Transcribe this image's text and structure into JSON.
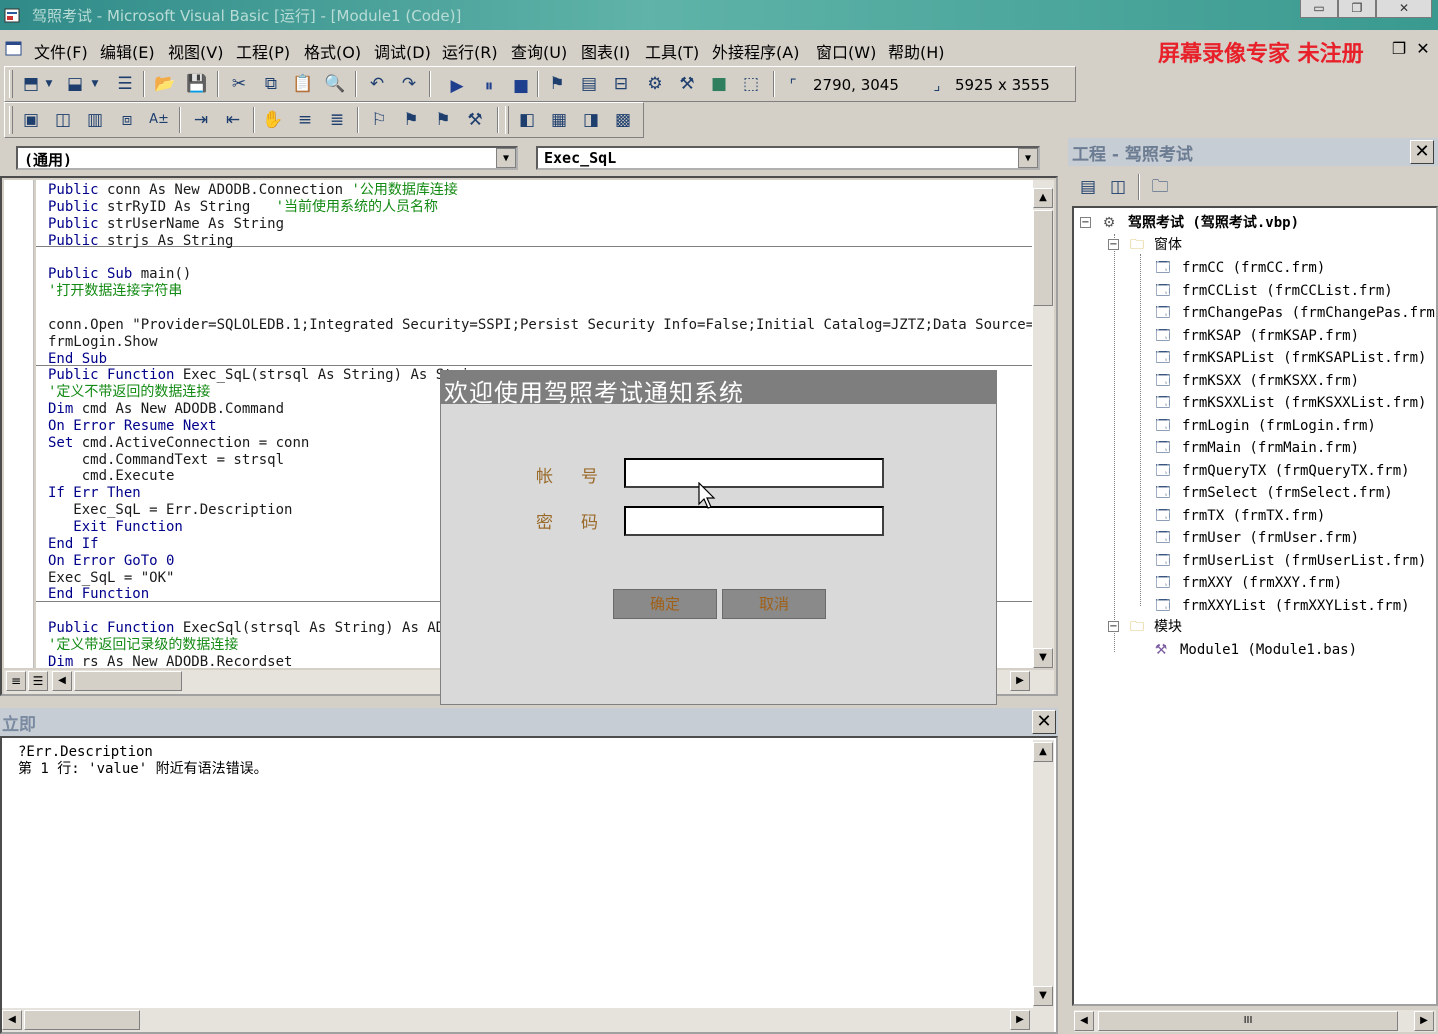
{
  "window": {
    "title": "驾照考试 - Microsoft Visual Basic [运行] - [Module1 (Code)]",
    "buttons": {
      "minimize": "▭",
      "restore": "❐",
      "close": "✕"
    }
  },
  "menubar": {
    "items": [
      "文件(F)",
      "编辑(E)",
      "视图(V)",
      "工程(P)",
      "格式(O)",
      "调试(D)",
      "运行(R)",
      "查询(U)",
      "图表(I)",
      "工具(T)",
      "外接程序(A)",
      "窗口(W)",
      "帮助(H)"
    ],
    "watermark": "屏幕录像专家 未注册",
    "mdi_restore": "❐",
    "mdi_close": "✕"
  },
  "toolbar": {
    "position_readout": "2790, 3045",
    "size_readout": "5925 x 3555"
  },
  "code_window": {
    "object_combo": "(通用)",
    "procedure_combo": "Exec_SqL",
    "lines": [
      {
        "kw": "Public",
        "rest": " conn As New ADODB.Connection ",
        "comment": "'公用数据库连接"
      },
      {
        "kw": "Public",
        "rest": " strRyID As String   ",
        "comment": "'当前使用系统的人员名称"
      },
      {
        "kw": "Public",
        "rest": " strUserName As String",
        "comment": ""
      },
      {
        "kw": "Public",
        "rest": " strjs As String",
        "comment": ""
      },
      {
        "kw": "",
        "rest": "",
        "comment": ""
      },
      {
        "kw": "Public Sub",
        "rest": " main()",
        "comment": ""
      },
      {
        "kw": "",
        "rest": "",
        "comment": "'打开数据连接字符串"
      },
      {
        "kw": "",
        "rest": "",
        "comment": ""
      },
      {
        "kw": "",
        "rest": "conn.Open \"Provider=SQLOLEDB.1;Integrated Security=SSPI;Persist Security Info=False;Initial Catalog=JZTZ;Data Source=",
        "comment": ""
      },
      {
        "kw": "",
        "rest": "frmLogin.Show",
        "comment": ""
      },
      {
        "kw": "End Sub",
        "rest": "",
        "comment": ""
      },
      {
        "kw": "Public Function",
        "rest": " Exec_SqL(strsql As String) As String",
        "comment": ""
      },
      {
        "kw": "",
        "rest": "",
        "comment": "'定义不带返回的数据连接"
      },
      {
        "kw": "Dim",
        "rest": " cmd As New ADODB.Command",
        "comment": ""
      },
      {
        "kw": "On Error Resume Next",
        "rest": "",
        "comment": ""
      },
      {
        "kw": "Set",
        "rest": " cmd.ActiveConnection = conn",
        "comment": ""
      },
      {
        "kw": "",
        "rest": "    cmd.CommandText = strsql",
        "comment": ""
      },
      {
        "kw": "",
        "rest": "    cmd.Execute",
        "comment": ""
      },
      {
        "kw": "If Err Then",
        "rest": "",
        "comment": ""
      },
      {
        "kw": "",
        "rest": "   Exec_SqL = Err.Description",
        "comment": ""
      },
      {
        "kw": "   Exit Function",
        "rest": "",
        "comment": ""
      },
      {
        "kw": "End If",
        "rest": "",
        "comment": ""
      },
      {
        "kw": "On Error GoTo 0",
        "rest": "",
        "comment": ""
      },
      {
        "kw": "",
        "rest": "Exec_SqL = \"OK\"",
        "comment": ""
      },
      {
        "kw": "End Function",
        "rest": "",
        "comment": ""
      },
      {
        "kw": "",
        "rest": "",
        "comment": ""
      },
      {
        "kw": "Public Function",
        "rest": " ExecSql(strsql As String) As ADODB.Recordset",
        "comment": ""
      },
      {
        "kw": "",
        "rest": "",
        "comment": "'定义带返回记录级的数据连接"
      },
      {
        "kw": "Dim",
        "rest": " rs As New ADODB.Recordset",
        "comment": ""
      }
    ]
  },
  "immediate_window": {
    "title": "立即",
    "lines": [
      "?Err.Description",
      "第 1 行: 'value' 附近有语法错误。"
    ]
  },
  "project_explorer": {
    "title": "工程 - 驾照考试",
    "root": "驾照考试 (驾照考试.vbp)",
    "forms_folder": "窗体",
    "forms": [
      "frmCC (frmCC.frm)",
      "frmCCList (frmCCList.frm)",
      "frmChangePas (frmChangePas.frm)",
      "frmKSAP (frmKSAP.frm)",
      "frmKSAPList (frmKSAPList.frm)",
      "frmKSXX (frmKSXX.frm)",
      "frmKSXXList (frmKSXXList.frm)",
      "frmLogin (frmLogin.frm)",
      "frmMain (frmMain.frm)",
      "frmQueryTX (frmQueryTX.frm)",
      "frmSelect (frmSelect.frm)",
      "frmTX (frmTX.frm)",
      "frmUser (frmUser.frm)",
      "frmUserList (frmUserList.frm)",
      "frmXXY (frmXXY.frm)",
      "frmXXYList (frmXXYList.frm)"
    ],
    "modules_folder": "模块",
    "modules": [
      "Module1 (Module1.bas)"
    ],
    "hscroll_thumb": "III"
  },
  "login_dialog": {
    "title": "欢迎使用驾照考试通知系统",
    "account_label": "帐号",
    "password_label": "密码",
    "account_value": "",
    "password_value": "",
    "ok_button": "确定",
    "cancel_button": "取消"
  },
  "colors": {
    "keyword": "#00008b",
    "comment": "#138a13",
    "watermark": "#e8202a"
  }
}
